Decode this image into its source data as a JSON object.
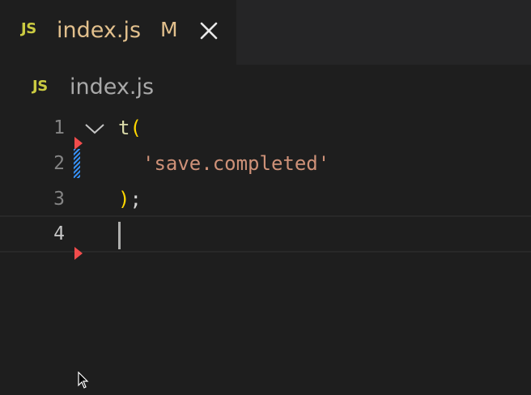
{
  "tab": {
    "icon_label": "JS",
    "file_name": "index.js",
    "status": "M"
  },
  "breadcrumb": {
    "icon_label": "JS",
    "file_name": "index.js"
  },
  "editor": {
    "lines": [
      {
        "number": "1",
        "fn": "t",
        "paren": "("
      },
      {
        "number": "2",
        "string": "'save.completed'"
      },
      {
        "number": "3",
        "close_paren": ")",
        "semicolon": ";"
      },
      {
        "number": "4"
      }
    ]
  },
  "colors": {
    "background": "#1e1e1e",
    "tabbar": "#252526",
    "js_icon": "#cbcb41",
    "modified_text": "#e2c08d",
    "function": "#dcdcaa",
    "bracket": "#ffd700",
    "string": "#ce9178",
    "error_marker": "#f14c4c",
    "added_marker": "#3794ff"
  },
  "icons": {
    "close": "close-icon",
    "fold": "chevron-down-icon",
    "pointer": "mouse-pointer-icon"
  }
}
